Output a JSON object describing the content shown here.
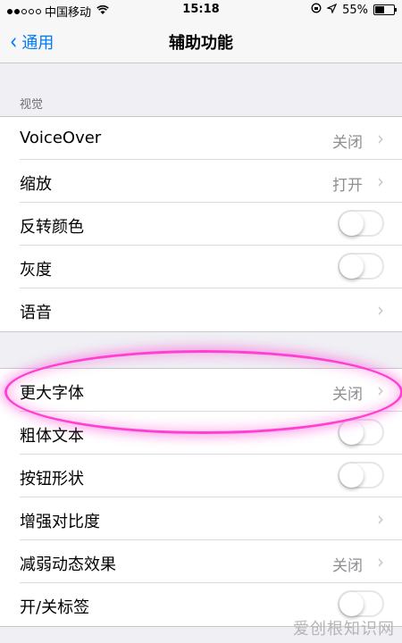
{
  "status_bar": {
    "carrier": "中国移动",
    "time": "15:18",
    "battery_text": "55%",
    "battery_level": 0.55
  },
  "nav": {
    "back_label": "通用",
    "title": "辅助功能"
  },
  "section_vision": {
    "header": "视觉",
    "rows": [
      {
        "label": "VoiceOver",
        "value": "关闭"
      },
      {
        "label": "缩放",
        "value": "打开"
      },
      {
        "label": "反转颜色"
      },
      {
        "label": "灰度"
      },
      {
        "label": "语音"
      }
    ]
  },
  "section_text": {
    "rows": [
      {
        "label": "更大字体",
        "value": "关闭"
      },
      {
        "label": "粗体文本"
      },
      {
        "label": "按钮形状"
      },
      {
        "label": "增强对比度"
      },
      {
        "label": "减弱动态效果",
        "value": "关闭"
      },
      {
        "label": "开/关标签"
      }
    ]
  },
  "watermark": "爱创根知识网",
  "colors": {
    "accent": "#007aff",
    "highlight": "#ff3fd2"
  },
  "icons": {
    "back": "chevron-left-icon",
    "disclosure": "chevron-right-icon",
    "wifi": "wifi-icon"
  }
}
